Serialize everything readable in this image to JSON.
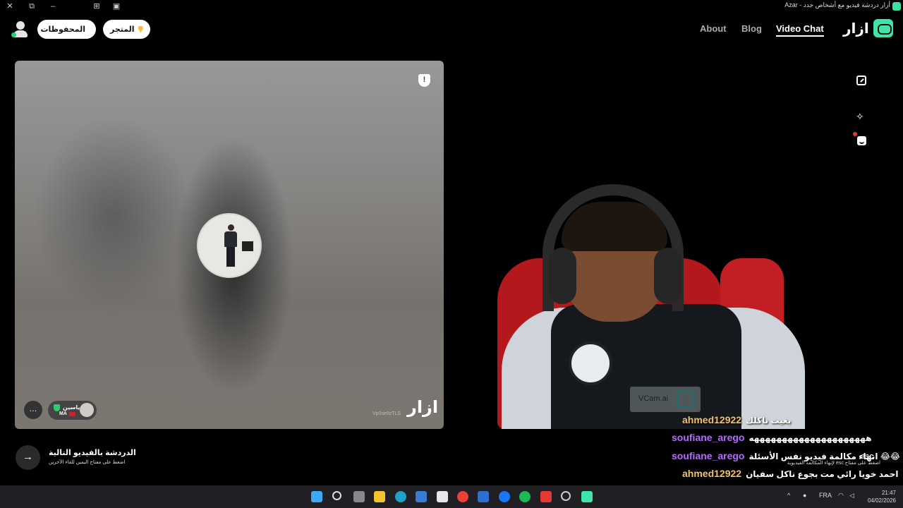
{
  "window": {
    "title": "أزار دردشة فيديو مع أشخاص جدد - Azar",
    "controls": {
      "close": "✕",
      "restore": "⧉",
      "minimize": "–",
      "extension": "⊞",
      "sidebar": "▣"
    }
  },
  "header": {
    "saved_label": "المحفوظات",
    "shop_label": "المتجر",
    "nav": {
      "about": "About",
      "blog": "Blog",
      "video_chat": "Video Chat"
    },
    "logo_text": "ازار"
  },
  "partner_panel": {
    "report_icon_glyph": "!",
    "chat_icon_glyph": "…",
    "user_name": "ياسين",
    "country_code": "MA",
    "user_id": "Vp0se9zTLS",
    "watermark": "ازار"
  },
  "self_panel": {
    "vcam_label": "VCam.ai",
    "magic_icon_glyph": "✧"
  },
  "bottom": {
    "next_arrow": "→",
    "next_title": "الدردشة بالفيديو التالية",
    "next_subtitle": "اضغط على مفتاح اليمين للقاء الآخرين",
    "esc_key": "esc",
    "esc_hint": "اضغط على مفتاح esc لإنهاء المكالمة الفيديوية"
  },
  "chat_overlay": [
    {
      "user": "ahmed12922",
      "message": "بغيت ناكلك",
      "color": "#f5c16c"
    },
    {
      "user": "soufiane_arego",
      "message": "هههههههههههههههههههههه",
      "color": "#b36bff"
    },
    {
      "user": "soufiane_arego",
      "message": "انهاء مكالمة فيديو نفس الأسئلة 😂😂",
      "color": "#b36bff"
    },
    {
      "user": "ahmed12922",
      "message": "احمد خويا رائي مت بجوع ناكل سفيان",
      "color": "#f5c16c"
    }
  ],
  "taskbar": {
    "language": "FRA",
    "time": "21:47",
    "date": "04/02/2026"
  }
}
